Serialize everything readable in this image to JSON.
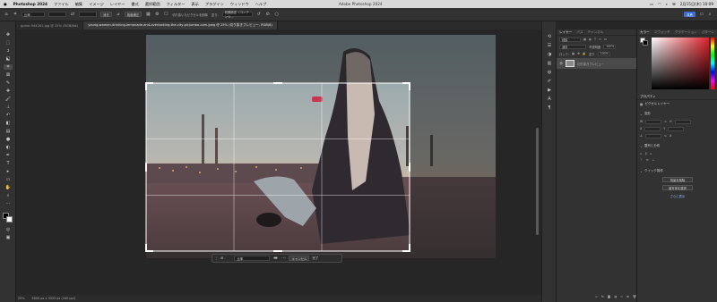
{
  "menubar": {
    "items": [
      "Photoshop 2024",
      "ファイル",
      "編集",
      "イメージ",
      "レイヤー",
      "書式",
      "選択範囲",
      "フィルター",
      "表示",
      "プラグイン",
      "ウィンドウ",
      "ヘルプ"
    ],
    "datetime": "2月15日(木) 10:09"
  },
  "window_title": "Adobe Photoshop 2024",
  "options": {
    "ratio": "比率",
    "clear": "消去",
    "straighten": "角度補正",
    "delete_cropped": "切り抜いたピクセルを削除",
    "fill": "塗り: ",
    "fill_mode": "初期設定（コンテンツ...",
    "share": "共有"
  },
  "tabs": [
    {
      "label": "guitar-944261.jpg @ 25% (RGB/8#)"
    },
    {
      "label": "young-woman-drinking-lemonade-and-overlooking-the-city-picjumbo-com.jpeg @ 25% (切り抜きプレビュー, RGB/8)"
    }
  ],
  "crop_context_bar": {
    "aspect_label": "比率",
    "cancel": "キャンセル",
    "commit": "完了"
  },
  "status": {
    "zoom": "25%",
    "doc_info": "5000 px x 3333 px (240 ppi)"
  },
  "layers_panel": {
    "tabs": [
      "レイヤー",
      "パス",
      "チャンネル"
    ],
    "kind_label": "種類",
    "blend_mode": "通常",
    "opacity_label": "不透明度",
    "opacity": "100%",
    "lock_label": "ロック:",
    "fill_label": "塗り",
    "fill": "100%",
    "layer_name": "切り抜きプレビュー"
  },
  "color_panel": {
    "tabs": [
      "カラー",
      "スウォッチ",
      "グラデーション",
      "パターン"
    ]
  },
  "properties_panel": {
    "tabs": [
      "プロパティ"
    ],
    "layer_type": "ピクセルレイヤー",
    "transform_title": "変形",
    "align_title": "整列と分布",
    "quick_actions_title": "クイック操作",
    "actions": [
      "背景を削除",
      "被写体を選択",
      "さらに表示"
    ]
  }
}
